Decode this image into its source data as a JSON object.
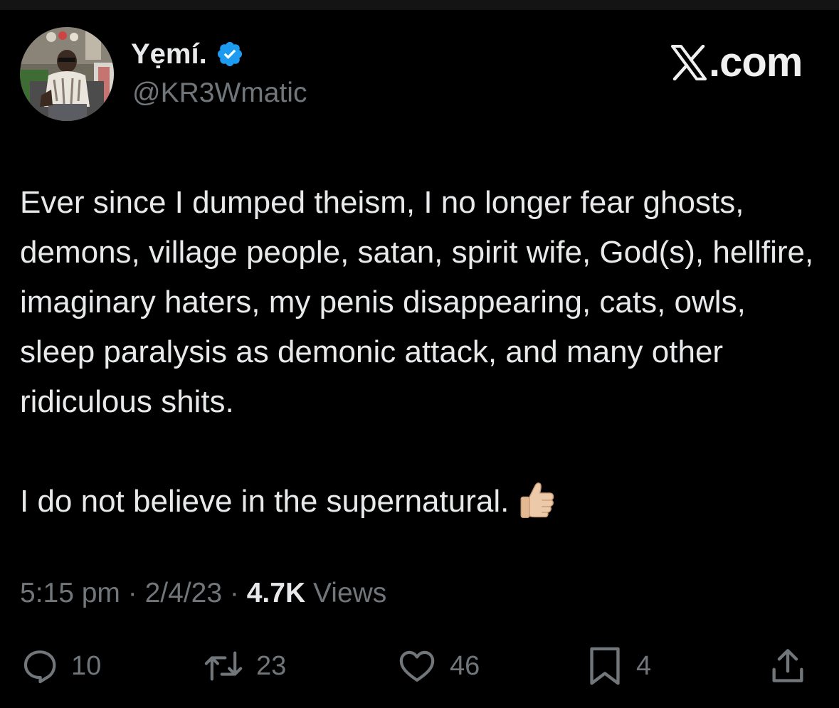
{
  "author": {
    "display_name": "Yẹmí.",
    "handle": "@KR3Wmatic",
    "verified": true,
    "verified_color": "#1d9bf0"
  },
  "brand": {
    "text": ".com",
    "logo_icon": "x-logo-icon"
  },
  "tweet": {
    "paragraph_1": "Ever since I dumped theism, I no longer fear ghosts, demons, village people, satan, spirit wife, God(s), hellfire, imaginary haters, my penis disappearing, cats, owls, sleep paralysis as demonic attack, and many other ridiculous shits.",
    "paragraph_2": "I do not believe in the supernatural.",
    "emoji": "thumbs-up-icon"
  },
  "meta": {
    "time": "5:15 pm",
    "separator": "·",
    "date": "2/4/23",
    "views_count": "4.7K",
    "views_label": "Views"
  },
  "actions": {
    "replies": "10",
    "reposts": "23",
    "likes": "46",
    "bookmarks": "4"
  },
  "colors": {
    "background": "#000000",
    "primary_text": "#e7e9ea",
    "secondary_text": "#71767b"
  }
}
